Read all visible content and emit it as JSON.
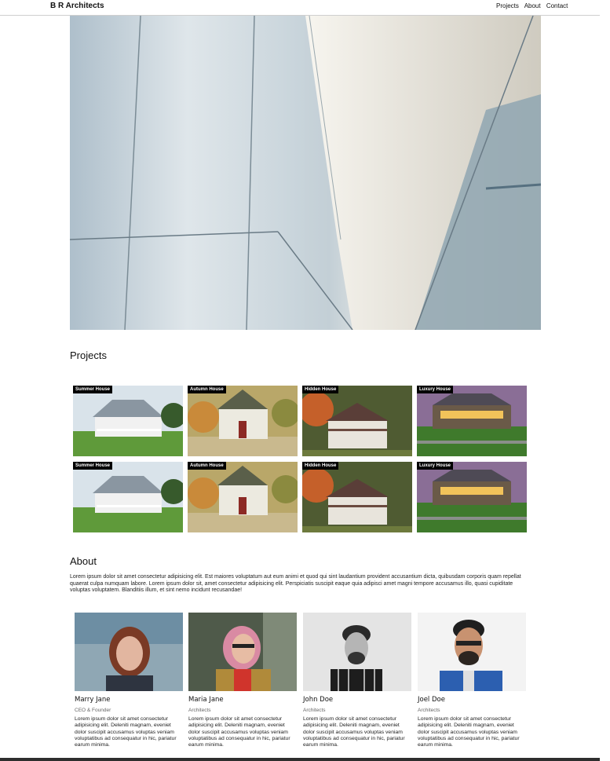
{
  "nav": {
    "brand": "B R Architects",
    "links": [
      "Projects",
      "About",
      "Contact"
    ]
  },
  "projects": {
    "title": "Projects",
    "items": [
      {
        "label": "Summer House"
      },
      {
        "label": "Autumn House"
      },
      {
        "label": "Hidden House"
      },
      {
        "label": "Luxury House"
      },
      {
        "label": "Summer House"
      },
      {
        "label": "Autumn House"
      },
      {
        "label": "Hidden House"
      },
      {
        "label": "Luxury House"
      }
    ]
  },
  "about": {
    "title": "About",
    "text": "Lorem ipsum dolor sit amet consectetur adipisicing elit. Est maiores voluptatum aut eum animi et quod qui sint laudantium provident accusantium dicta, quibusdam corporis quam repellat quaerat culpa numquam labore. Lorem ipsum dolor sit, amet consectetur adipisicing elit. Perspiciatis suscipit eaque quia adipisci amet magni tempore accusamus illo, quasi cupiditate voluptas voluptatem. Blanditiis illum, et sint nemo incidunt recusandae!"
  },
  "team": [
    {
      "name": "Marry Jane",
      "role": "CEO & Founder",
      "desc": "Lorem ipsum dolor sit amet consectetur adipisicing elit. Deleniti magnam, eveniet dolor suscipit accusamus voluptas veniam voluptatibus ad consequatur in hic, pariatur earum minima."
    },
    {
      "name": "Maria Jane",
      "role": "Architects",
      "desc": "Lorem ipsum dolor sit amet consectetur adipisicing elit. Deleniti magnam, eveniet dolor suscipit accusamus voluptas veniam voluptatibus ad consequatur in hic, pariatur earum minima."
    },
    {
      "name": "John Doe",
      "role": "Architects",
      "desc": "Lorem ipsum dolor sit amet consectetur adipisicing elit. Deleniti magnam, eveniet dolor suscipit accusamus voluptas veniam voluptatibus ad consequatur in hic, pariatur earum minima."
    },
    {
      "name": "Joel Doe",
      "role": "Architects",
      "desc": "Lorem ipsum dolor sit amet consectetur adipisicing elit. Deleniti magnam, eveniet dolor suscipit accusamus voluptas veniam voluptatibus ad consequatur in hic, pariatur earum minima."
    }
  ]
}
